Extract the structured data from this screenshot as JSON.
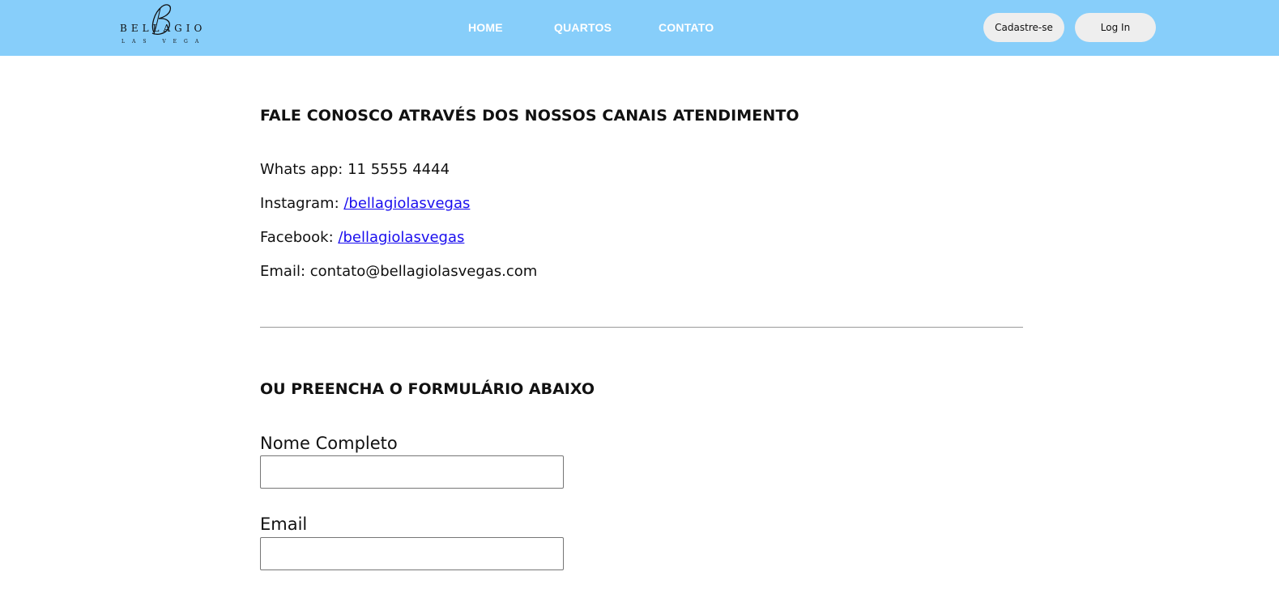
{
  "header": {
    "logo": {
      "name": "BELLAGIO",
      "subtitle": "LAS VEGAS",
      "monogram": "B"
    },
    "nav": [
      {
        "label": "HOME"
      },
      {
        "label": "QUARTOS"
      },
      {
        "label": "CONTATO"
      }
    ],
    "signup_label": "Cadastre-se",
    "login_label": "Log In",
    "background_color": "#87cefa"
  },
  "contact": {
    "heading": "FALE CONOSCO ATRAVÉS DOS NOSSOS CANAIS ATENDIMENTO",
    "whatsapp": {
      "label": "Whats app: ",
      "value": "11 5555 4444"
    },
    "instagram": {
      "label": "Instagram: ",
      "link": "/bellagiolasvegas"
    },
    "facebook": {
      "label": "Facebook: ",
      "link": "/bellagiolasvegas"
    },
    "email": {
      "label": "Email: ",
      "value": "contato@bellagiolasvegas.com"
    },
    "link_color": "#1a0dee"
  },
  "form": {
    "heading": "OU PREENCHA O FORMULÁRIO ABAIXO",
    "fields": [
      {
        "label": "Nome Completo",
        "value": ""
      },
      {
        "label": "Email",
        "value": ""
      }
    ]
  }
}
